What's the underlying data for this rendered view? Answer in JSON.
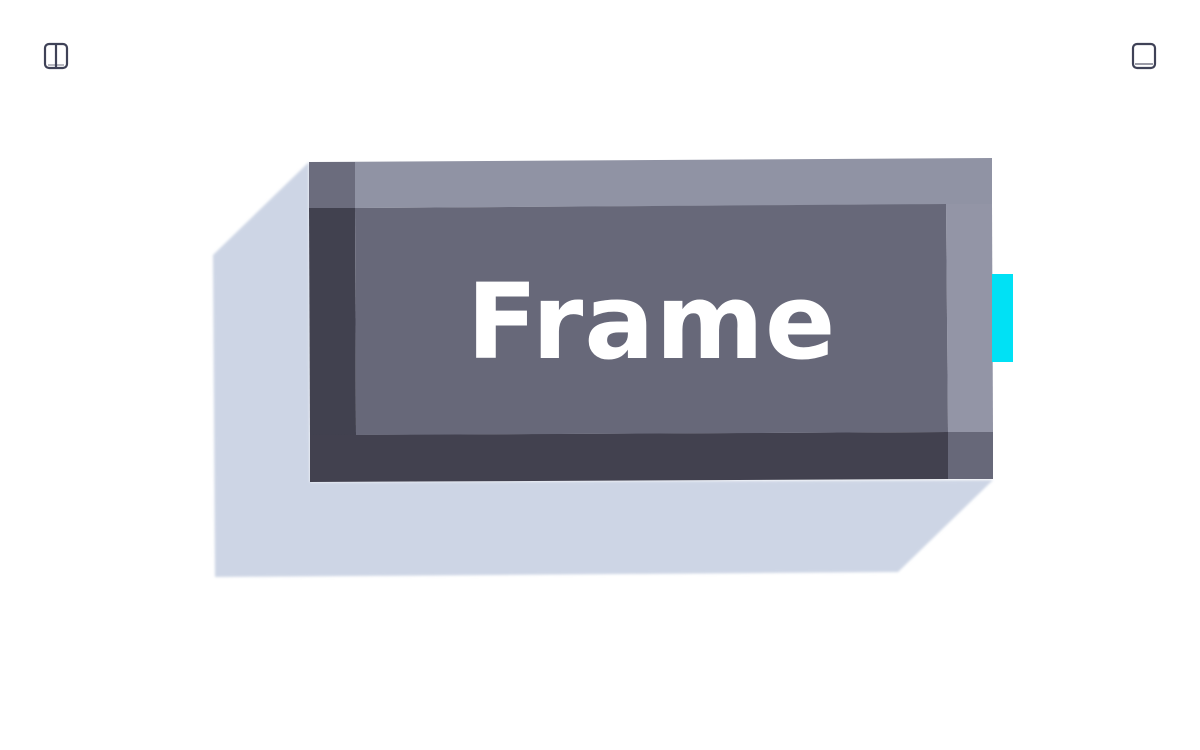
{
  "toolbar": {
    "left_icon": "split-panel-icon",
    "right_icon": "single-panel-icon",
    "icon_color": "#3f4257"
  },
  "frame_button": {
    "label": "Frame",
    "colors": {
      "face": "#676879",
      "top_bevel": "#9093a4",
      "left_bevel": "#41414f",
      "right_bevel": "#9395a6",
      "bottom_bevel": "#42414f",
      "corner_top_left": "#6b6c7d",
      "corner_bottom_right": "#676879",
      "shadow": "#cdd5e5",
      "label": "#ffffff"
    }
  },
  "side_tab": {
    "icon": "side-handle",
    "color": "#00e1f5"
  }
}
